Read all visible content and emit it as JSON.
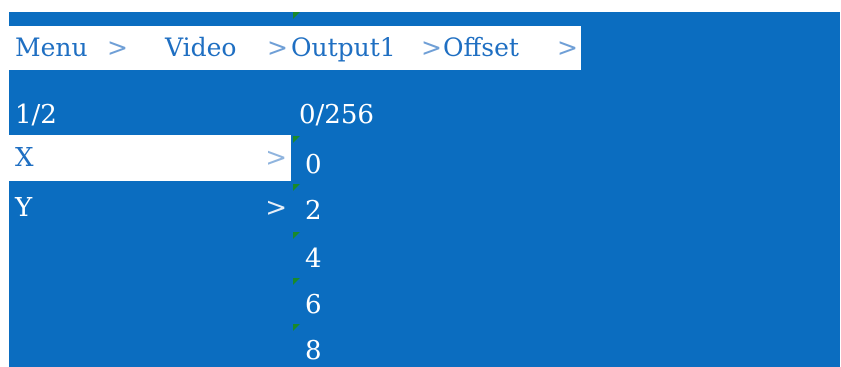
{
  "breadcrumb": {
    "menu": "Menu",
    "video": "Video",
    "output": "Output1",
    "offset": "Offset",
    "sep": ">"
  },
  "page_indicator": "1/2",
  "menu_items": [
    {
      "label": "X",
      "chevron": ">",
      "selected": true
    },
    {
      "label": "Y",
      "chevron": ">",
      "selected": false
    }
  ],
  "value_range": "0/256",
  "values": [
    "0",
    "2",
    "4",
    "6",
    "8"
  ],
  "colors": {
    "screen_background": "#0b6dc0",
    "highlight_background": "#ffffff",
    "highlight_text": "#1f6fc2",
    "text": "#ffffff",
    "marker": "#1a8a2a"
  }
}
